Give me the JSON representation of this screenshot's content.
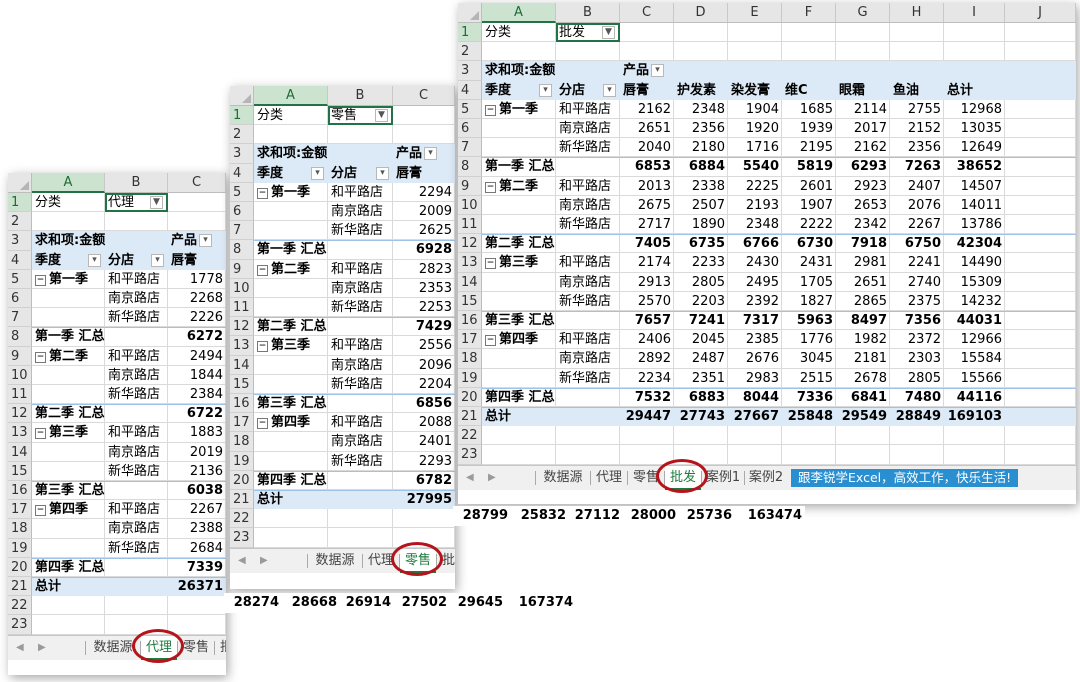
{
  "tabs": [
    "数据源",
    "代理",
    "零售",
    "批发",
    "案例1",
    "案例2"
  ],
  "banner": "跟李锐学Excel，高效工作，快乐生活!",
  "col_letters": [
    "A",
    "B",
    "C",
    "D",
    "E",
    "F",
    "G",
    "H",
    "I",
    "J"
  ],
  "labels": {
    "filter_label": "分类",
    "sum_label": "求和项:金额",
    "product_label": "产品",
    "season_label": "季度",
    "store_label": "分店",
    "total_label": "总计"
  },
  "products": [
    "唇膏",
    "护发素",
    "染发膏",
    "维C",
    "眼霜",
    "鱼油"
  ],
  "stores": [
    "和平路店",
    "南京路店",
    "新华路店"
  ],
  "seasons": [
    "第一季",
    "第二季",
    "第三季",
    "第四季"
  ],
  "season_totals": [
    "第一季 汇总",
    "第二季 汇总",
    "第三季 汇总",
    "第四季 汇总"
  ],
  "sheets": {
    "agent": {
      "filter_value": "代理",
      "c_col": [
        "1778",
        "2268",
        "2226",
        "6272",
        "2494",
        "1844",
        "2384",
        "6722",
        "1883",
        "2019",
        "2136",
        "6038",
        "2267",
        "2388",
        "2684",
        "7339"
      ],
      "grand_total": [
        "26371",
        "28274",
        "28668",
        "26914",
        "27502",
        "29645",
        "167374"
      ]
    },
    "retail": {
      "filter_value": "零售",
      "c_col": [
        "2294",
        "2009",
        "2625",
        "6928",
        "2823",
        "2353",
        "2253",
        "7429",
        "2556",
        "2096",
        "2204",
        "6856",
        "2088",
        "2401",
        "2293",
        "6782"
      ],
      "grand_total": [
        "27995",
        "28799",
        "25832",
        "27112",
        "28000",
        "25736",
        "163474"
      ]
    },
    "wholesale": {
      "filter_value": "批发",
      "rows": [
        [
          "2162",
          "2348",
          "1904",
          "1685",
          "2114",
          "2755",
          "12968"
        ],
        [
          "2651",
          "2356",
          "1920",
          "1939",
          "2017",
          "2152",
          "13035"
        ],
        [
          "2040",
          "2180",
          "1716",
          "2195",
          "2162",
          "2356",
          "12649"
        ],
        [
          "6853",
          "6884",
          "5540",
          "5819",
          "6293",
          "7263",
          "38652"
        ],
        [
          "2013",
          "2338",
          "2225",
          "2601",
          "2923",
          "2407",
          "14507"
        ],
        [
          "2675",
          "2507",
          "2193",
          "1907",
          "2653",
          "2076",
          "14011"
        ],
        [
          "2717",
          "1890",
          "2348",
          "2222",
          "2342",
          "2267",
          "13786"
        ],
        [
          "7405",
          "6735",
          "6766",
          "6730",
          "7918",
          "6750",
          "42304"
        ],
        [
          "2174",
          "2233",
          "2430",
          "2431",
          "2981",
          "2241",
          "14490"
        ],
        [
          "2913",
          "2805",
          "2495",
          "1705",
          "2651",
          "2740",
          "15309"
        ],
        [
          "2570",
          "2203",
          "2392",
          "1827",
          "2865",
          "2375",
          "14232"
        ],
        [
          "7657",
          "7241",
          "7317",
          "5963",
          "8497",
          "7356",
          "44031"
        ],
        [
          "2406",
          "2045",
          "2385",
          "1776",
          "1982",
          "2372",
          "12966"
        ],
        [
          "2892",
          "2487",
          "2676",
          "3045",
          "2181",
          "2303",
          "15584"
        ],
        [
          "2234",
          "2351",
          "2983",
          "2515",
          "2678",
          "2805",
          "15566"
        ],
        [
          "7532",
          "6883",
          "8044",
          "7336",
          "6841",
          "7480",
          "44116"
        ]
      ],
      "grand_total": [
        "29447",
        "27743",
        "27667",
        "25848",
        "29549",
        "28849",
        "169103"
      ]
    }
  }
}
